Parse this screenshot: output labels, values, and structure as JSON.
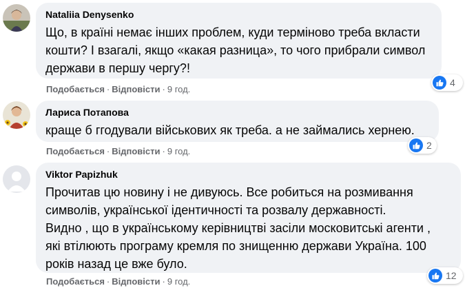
{
  "comments": [
    {
      "author": "Nataliia Denysenko",
      "text": "Що, в країні немає інших проблем, куди терміново треба вкласти\nкошти? І взагалі, якщо «какая разница», то чого прибрали символ\nдержави в першу чергу?!",
      "like_label": "Подобається",
      "reply_label": "Відповісти",
      "time": "9 год.",
      "reaction_count": "4",
      "separator": "·"
    },
    {
      "author": "Лариса Потапова",
      "text": "краще б ггодували військових як треба. а не займались хернею.",
      "like_label": "Подобається",
      "reply_label": "Відповісти",
      "time": "9 год.",
      "reaction_count": "2",
      "separator": "·"
    },
    {
      "author": "Viktor Papizhuk",
      "text": "Прочитав цю новину і не дивуюсь. Все робиться на розмивання\nсимволів, української ідентичності та розвалу державності.\nВидно , що в українському керівництві засіли московитські агенти ,\nякі втілюють програму кремля по знищенню держави Україна. 100\nроків назад це вже було.",
      "like_label": "Подобається",
      "reply_label": "Відповісти",
      "time": "9 год.",
      "reaction_count": "12",
      "separator": "·"
    }
  ],
  "colors": {
    "bubble": "#f0f2f5",
    "meta": "#65676b",
    "like_blue": "#1877f2",
    "text": "#050505"
  }
}
